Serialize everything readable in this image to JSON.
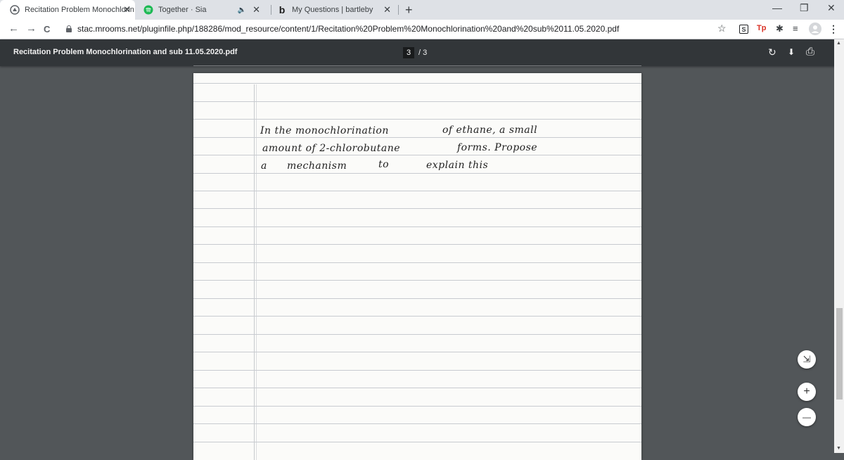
{
  "tabs": [
    {
      "title": "Recitation Problem Monochlorin",
      "close": "✕",
      "favicon": "moodle-icon"
    },
    {
      "title": "Together · Sia",
      "close": "✕",
      "audio": "🔈",
      "favicon": "spotify-icon"
    },
    {
      "title": "My Questions | bartleby",
      "close": "✕",
      "favicon": "bartleby-icon"
    }
  ],
  "new_tab": "+",
  "window": {
    "minimize": "—",
    "maximize": "❐",
    "close": "✕"
  },
  "nav": {
    "back": "←",
    "forward": "→",
    "reload": "C"
  },
  "address": {
    "url": "stac.mrooms.net/pluginfile.php/188286/mod_resource/content/1/Recitation%20Problem%20Monochlorination%20and%20sub%2011.05.2020.pdf"
  },
  "toolbar_icons": {
    "star": "☆",
    "ext1": "S",
    "ext2": "Tp",
    "puzzle": "✱",
    "media": "≡",
    "menu": "⋮"
  },
  "pdf": {
    "title": "Recitation Problem Monochlorination and sub 11.05.2020.pdf",
    "current_page": "3",
    "total_pages": "/ 3"
  },
  "pdf_icons": {
    "rotate": "↻",
    "download": "⬇",
    "print": "⎙"
  },
  "handwriting": {
    "line1a": "In  the  monochlorination",
    "line1b": "of  ethane,   a   small",
    "line2a": "amount  of  2-chlorobutane",
    "line2b": "forms.  Propose",
    "line3a": "a",
    "line3b": "mechanism",
    "line3c": "to",
    "line3d": "explain  this"
  },
  "zoom": {
    "fit": "⇲",
    "in": "+",
    "out": "—"
  },
  "colors": {
    "page_bg": "#fbfbf9",
    "viewer_bg": "#525659",
    "toolbar_bg": "#323639",
    "rule": "#c8cbd0",
    "spotify": "#1db954"
  }
}
